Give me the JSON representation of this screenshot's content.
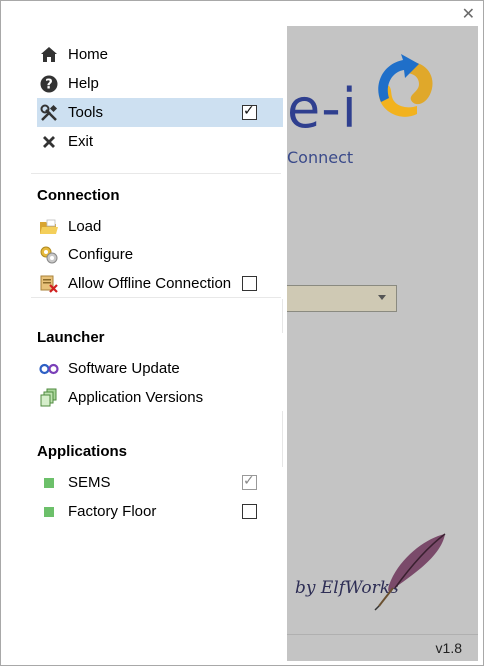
{
  "window": {
    "close_glyph": "✕"
  },
  "background": {
    "logo_text": "e-i",
    "subtitle": "Connect",
    "elfworks_text": "by ElfWorks",
    "version": "v1.8"
  },
  "menu": {
    "main_items": [
      {
        "label": "Home",
        "icon": "home-icon"
      },
      {
        "label": "Help",
        "icon": "help-icon"
      },
      {
        "label": "Tools",
        "icon": "tools-icon",
        "checked": true,
        "selected": true
      },
      {
        "label": "Exit",
        "icon": "exit-icon"
      }
    ],
    "sections": [
      {
        "title": "Connection",
        "items": [
          {
            "label": "Load",
            "icon": "folder-icon"
          },
          {
            "label": "Configure",
            "icon": "configure-icon"
          },
          {
            "label": "Allow Offline Connection",
            "icon": "offline-icon",
            "checked": false
          }
        ]
      },
      {
        "title": "Launcher",
        "items": [
          {
            "label": "Software Update",
            "icon": "software-update-icon"
          },
          {
            "label": "Application Versions",
            "icon": "application-versions-icon"
          }
        ]
      },
      {
        "title": "Applications",
        "items": [
          {
            "label": "SEMS",
            "icon": "green-square-icon",
            "checked": true,
            "disabled": true
          },
          {
            "label": "Factory Floor",
            "icon": "green-square-icon",
            "checked": false
          }
        ]
      }
    ]
  }
}
